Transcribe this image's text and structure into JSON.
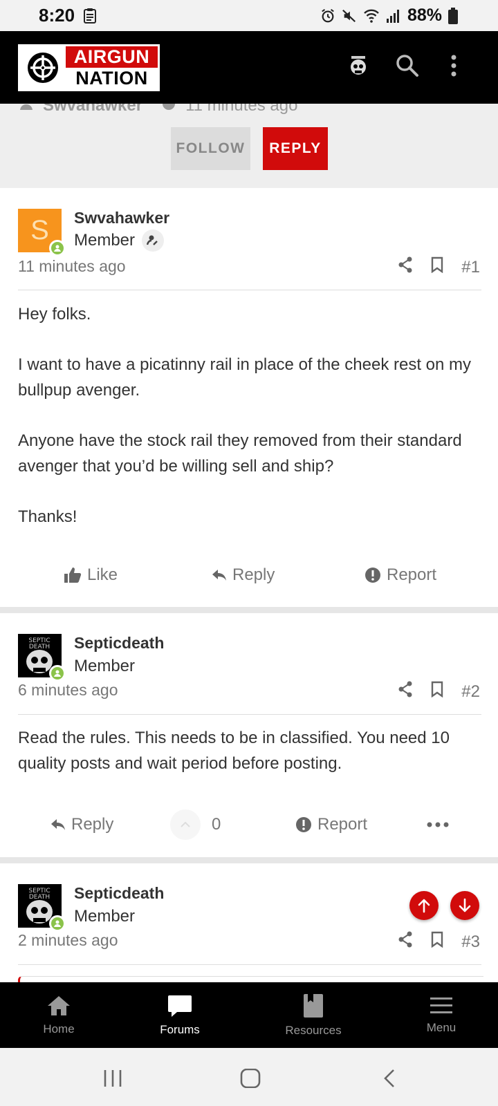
{
  "status_bar": {
    "time": "8:20",
    "battery": "88%"
  },
  "app_header": {
    "logo_line1": "AIRGUN",
    "logo_line2": "NATION",
    "icons": [
      "user-avatar",
      "search-icon",
      "more-vertical-icon"
    ]
  },
  "thread_header": {
    "author": "Swvahawker",
    "time": "11 minutes ago",
    "follow_label": "FOLLOW",
    "reply_label": "REPLY"
  },
  "posts": [
    {
      "username": "Swvahawker",
      "avatar_letter": "S",
      "role": "Member",
      "time": "11 minutes ago",
      "number": "#1",
      "body": [
        "Hey folks.",
        "I want to have a picatinny rail in place of the cheek rest on my bullpup avenger.",
        "Anyone have the stock rail they removed from their standard avenger that you’d be willing sell and ship?",
        "Thanks!"
      ],
      "footer": {
        "like": "Like",
        "reply": "Reply",
        "report": "Report"
      }
    },
    {
      "username": "Septicdeath",
      "role": "Member",
      "time": "6 minutes ago",
      "number": "#2",
      "body": [
        "Read the rules. This needs to be in classified. You need 10 quality posts and wait period before posting."
      ],
      "footer": {
        "reply": "Reply",
        "vote_count": "0",
        "report": "Report"
      }
    },
    {
      "username": "Septicdeath",
      "role": "Member",
      "time": "2 minutes ago",
      "number": "#3"
    }
  ],
  "bottom_nav": {
    "items": [
      {
        "label": "Home",
        "icon": "home-icon"
      },
      {
        "label": "Forums",
        "icon": "forums-icon",
        "active": true
      },
      {
        "label": "Resources",
        "icon": "resources-icon"
      },
      {
        "label": "Menu",
        "icon": "menu-icon"
      }
    ]
  },
  "colors": {
    "brand_red": "#d10b0b",
    "online_green": "#8bc34a",
    "avatar_orange": "#f7941d"
  }
}
